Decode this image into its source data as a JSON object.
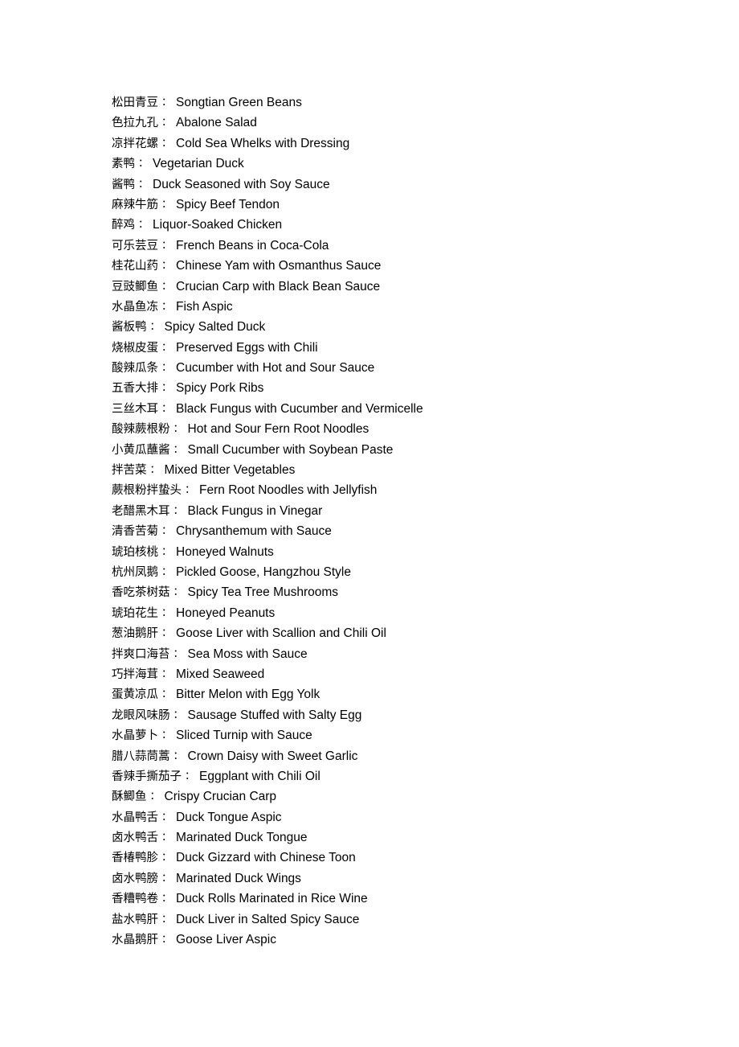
{
  "document": {
    "separator": "：",
    "text_color": "#000000",
    "background_color": "#ffffff",
    "entries": [
      {
        "cn": "松田青豆",
        "en": "Songtian Green Beans"
      },
      {
        "cn": "色拉九孔",
        "en": "Abalone Salad"
      },
      {
        "cn": "凉拌花螺",
        "en": "Cold Sea Whelks with Dressing"
      },
      {
        "cn": "素鸭",
        "en": "Vegetarian Duck"
      },
      {
        "cn": "酱鸭",
        "en": "Duck Seasoned with Soy Sauce"
      },
      {
        "cn": "麻辣牛筋",
        "en": "Spicy Beef Tendon"
      },
      {
        "cn": "醉鸡",
        "en": "Liquor-Soaked Chicken"
      },
      {
        "cn": "可乐芸豆",
        "en": "French Beans in Coca-Cola"
      },
      {
        "cn": "桂花山药",
        "en": "Chinese Yam with Osmanthus Sauce"
      },
      {
        "cn": "豆豉鲫鱼",
        "en": "Crucian Carp with Black Bean Sauce"
      },
      {
        "cn": "水晶鱼冻",
        "en": "Fish Aspic"
      },
      {
        "cn": "酱板鸭",
        "en": "Spicy Salted Duck"
      },
      {
        "cn": "烧椒皮蛋",
        "en": "Preserved Eggs with Chili"
      },
      {
        "cn": "酸辣瓜条",
        "en": "Cucumber with Hot and Sour Sauce"
      },
      {
        "cn": "五香大排",
        "en": "Spicy Pork Ribs"
      },
      {
        "cn": "三丝木耳",
        "en": "Black Fungus with Cucumber and Vermicelle"
      },
      {
        "cn": "酸辣蕨根粉",
        "en": "Hot and Sour Fern Root Noodles"
      },
      {
        "cn": "小黄瓜蘸酱",
        "en": "Small Cucumber with Soybean Paste"
      },
      {
        "cn": "拌苦菜",
        "en": "Mixed Bitter Vegetables"
      },
      {
        "cn": "蕨根粉拌蛰头",
        "en": "Fern Root Noodles with Jellyfish"
      },
      {
        "cn": "老醋黑木耳",
        "en": "Black Fungus in Vinegar"
      },
      {
        "cn": "清香苦菊",
        "en": "Chrysanthemum with Sauce"
      },
      {
        "cn": "琥珀核桃",
        "en": "Honeyed Walnuts"
      },
      {
        "cn": "杭州凤鹅",
        "en": "Pickled Goose, Hangzhou Style"
      },
      {
        "cn": "香吃茶树菇",
        "en": "Spicy Tea Tree Mushrooms"
      },
      {
        "cn": "琥珀花生",
        "en": "Honeyed Peanuts"
      },
      {
        "cn": "葱油鹅肝",
        "en": "Goose Liver with Scallion and Chili Oil"
      },
      {
        "cn": "拌爽口海苔",
        "en": "Sea Moss with Sauce"
      },
      {
        "cn": "巧拌海茸",
        "en": "Mixed Seaweed"
      },
      {
        "cn": "蛋黄凉瓜",
        "en": "Bitter Melon with Egg Yolk"
      },
      {
        "cn": "龙眼风味肠",
        "en": "Sausage Stuffed with Salty Egg"
      },
      {
        "cn": "水晶萝卜",
        "en": "Sliced Turnip with Sauce"
      },
      {
        "cn": "腊八蒜茼蒿",
        "en": "Crown Daisy with Sweet Garlic"
      },
      {
        "cn": "香辣手撕茄子",
        "en": "Eggplant with Chili Oil"
      },
      {
        "cn": "酥鲫鱼",
        "en": "Crispy Crucian Carp"
      },
      {
        "cn": "水晶鸭舌",
        "en": "Duck Tongue Aspic"
      },
      {
        "cn": "卤水鸭舌",
        "en": "Marinated Duck Tongue"
      },
      {
        "cn": "香椿鸭胗",
        "en": "Duck Gizzard with Chinese Toon"
      },
      {
        "cn": "卤水鸭膀",
        "en": "Marinated Duck Wings"
      },
      {
        "cn": "香糟鸭卷",
        "en": "Duck Rolls Marinated in Rice Wine"
      },
      {
        "cn": "盐水鸭肝",
        "en": "Duck Liver in Salted Spicy Sauce"
      },
      {
        "cn": "水晶鹅肝",
        "en": "Goose Liver Aspic"
      }
    ]
  }
}
